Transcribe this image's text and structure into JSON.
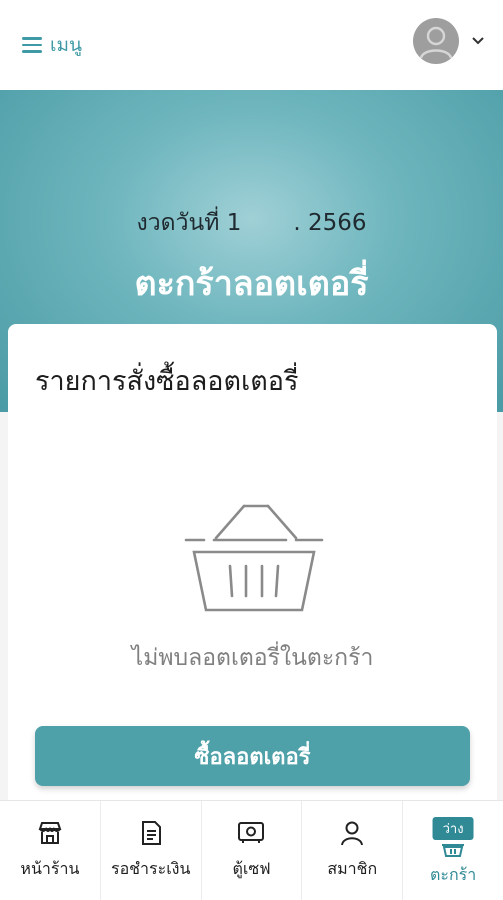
{
  "header": {
    "menu_label": "เมนู",
    "menu_icon": "hamburger-icon",
    "avatar_icon": "user-avatar-icon",
    "dropdown_icon": "chevron-down-icon"
  },
  "hero": {
    "draw_date_prefix": "งวดวันที่ 1",
    "draw_date_suffix": ". 2566",
    "title": "ตะกร้าลอตเตอรี่"
  },
  "order": {
    "title": "รายการสั่งซื้อลอตเตอรี่",
    "empty_icon": "empty-basket-icon",
    "empty_message": "ไม่พบลอตเตอรี่ในตะกร้า",
    "buy_button": "ซื้อลอตเตอรี่"
  },
  "nav": {
    "items": [
      {
        "label": "หน้าร้าน",
        "icon": "storefront-icon"
      },
      {
        "label": "รอชำระเงิน",
        "icon": "invoice-icon"
      },
      {
        "label": "ตู้เซฟ",
        "icon": "safe-icon"
      },
      {
        "label": "สมาชิก",
        "icon": "person-icon"
      },
      {
        "label": "ตะกร้า",
        "icon": "basket-icon",
        "badge": "ว่าง",
        "active": true
      }
    ]
  },
  "colors": {
    "accent": "#4ea0a9",
    "accent_dark": "#2f8a96",
    "hero_light": "#9fd0d6"
  }
}
